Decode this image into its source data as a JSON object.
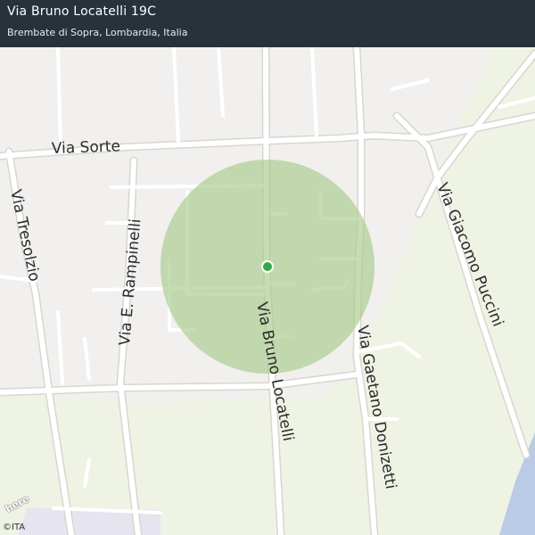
{
  "header": {
    "title": "Via Bruno Locatelli 19C",
    "subtitle": "Brembate di Sopra, Lombardia, Italia"
  },
  "streets": {
    "sorte": "Via  Sorte",
    "tresolzio": "Via  Tresolzio",
    "rampinelli": "Via  E.  Rampinelli",
    "locatelli": "Via  Bruno Locatelli",
    "donizetti": "Via Gaetano Donizetti",
    "puccini": "Via  Giacomo  Puccini"
  },
  "logo": "here",
  "copyright": "©ITA",
  "colors": {
    "header_bg": "#27323b",
    "urban_area": "#f1f0ee",
    "green_area": "#eef3e4",
    "radius_circle": "#a8c98a",
    "location_dot": "#3aa64a"
  }
}
